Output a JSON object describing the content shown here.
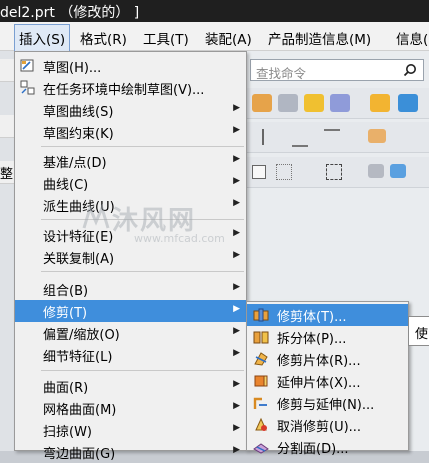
{
  "title_bar": {
    "text": "del2.prt （修改的） ]"
  },
  "menubar": {
    "items": [
      {
        "label": "插入(S)",
        "active": true
      },
      {
        "label": "格式(R)"
      },
      {
        "label": "工具(T)"
      },
      {
        "label": "装配(A)"
      },
      {
        "label": "产品制造信息(M)"
      },
      {
        "label": "信息("
      }
    ]
  },
  "search": {
    "placeholder": "查找命令",
    "icon": "magnifier-icon"
  },
  "left_strip": {
    "visible_char": "整"
  },
  "insert_menu": {
    "items": [
      {
        "label": "草图(H)...",
        "icon": "sketch-icon",
        "submenu": false
      },
      {
        "label": "在任务环境中绘制草图(V)...",
        "icon": "sketch-task-icon",
        "submenu": false
      },
      {
        "label": "草图曲线(S)",
        "submenu": true
      },
      {
        "label": "草图约束(K)",
        "submenu": true
      },
      {
        "label": "基准/点(D)",
        "submenu": true
      },
      {
        "label": "曲线(C)",
        "submenu": true
      },
      {
        "label": "派生曲线(U)",
        "submenu": true
      },
      {
        "label": "设计特征(E)",
        "submenu": true
      },
      {
        "label": "关联复制(A)",
        "submenu": true
      },
      {
        "label": "组合(B)",
        "submenu": true
      },
      {
        "label": "修剪(T)",
        "submenu": true,
        "highlighted": true
      },
      {
        "label": "偏置/缩放(O)",
        "submenu": true
      },
      {
        "label": "细节特征(L)",
        "submenu": true
      },
      {
        "label": "曲面(R)",
        "submenu": true
      },
      {
        "label": "网格曲面(M)",
        "submenu": true
      },
      {
        "label": "扫掠(W)",
        "submenu": true
      },
      {
        "label": "弯边曲面(G)",
        "submenu": true
      }
    ]
  },
  "trim_submenu": {
    "items": [
      {
        "label": "修剪体(T)...",
        "icon": "trim-body-icon",
        "highlighted": true
      },
      {
        "label": "拆分体(P)...",
        "icon": "split-body-icon"
      },
      {
        "label": "修剪片体(R)...",
        "icon": "trim-sheet-icon"
      },
      {
        "label": "延伸片体(X)...",
        "icon": "extend-sheet-icon"
      },
      {
        "label": "修剪与延伸(N)...",
        "icon": "trim-extend-icon"
      },
      {
        "label": "取消修剪(U)...",
        "icon": "untrim-icon"
      },
      {
        "label": "分割面(D)...",
        "icon": "divide-face-icon"
      }
    ]
  },
  "tooltip": {
    "text": "使"
  },
  "watermark": {
    "text": "沐风网",
    "url": "www.mfcad.com"
  },
  "colors": {
    "highlight": "#3f8edc",
    "menu_bg": "#f0f0f0",
    "titlebar": "#1f1f1f"
  }
}
